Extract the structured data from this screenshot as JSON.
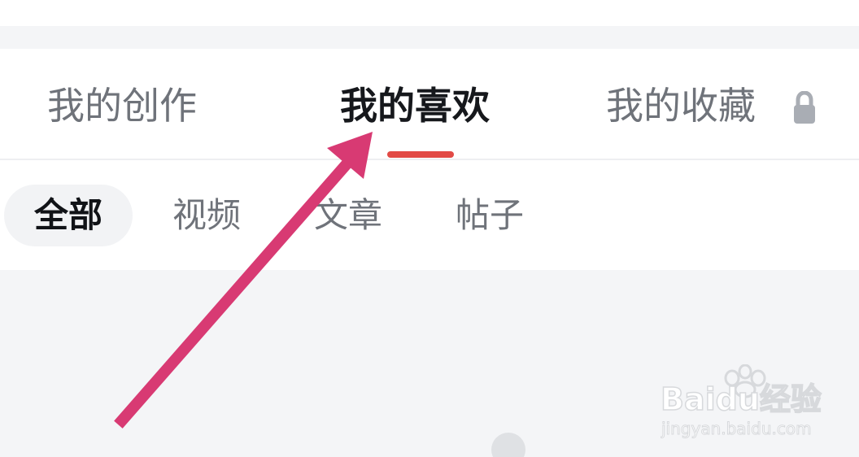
{
  "tabs": {
    "items": [
      {
        "label": "我的创作"
      },
      {
        "label": "我的喜欢"
      },
      {
        "label": "我的收藏"
      }
    ],
    "active_index": 1,
    "lock_icon": "lock-icon"
  },
  "filters": {
    "items": [
      {
        "label": "全部"
      },
      {
        "label": "视频"
      },
      {
        "label": "文章"
      },
      {
        "label": "帖子"
      }
    ],
    "active_index": 0
  },
  "annotation": {
    "arrow_icon": "annotation-arrow-icon",
    "arrow_color": "#d83a73"
  },
  "watermark": {
    "brand": "Baidu经验",
    "url": "jingyan.baidu.com"
  },
  "colors": {
    "active_text": "#16181c",
    "inactive_text": "#6f737a",
    "indicator": "#e24a45",
    "chip_bg": "#f2f3f5",
    "page_bg": "#f4f5f7"
  }
}
